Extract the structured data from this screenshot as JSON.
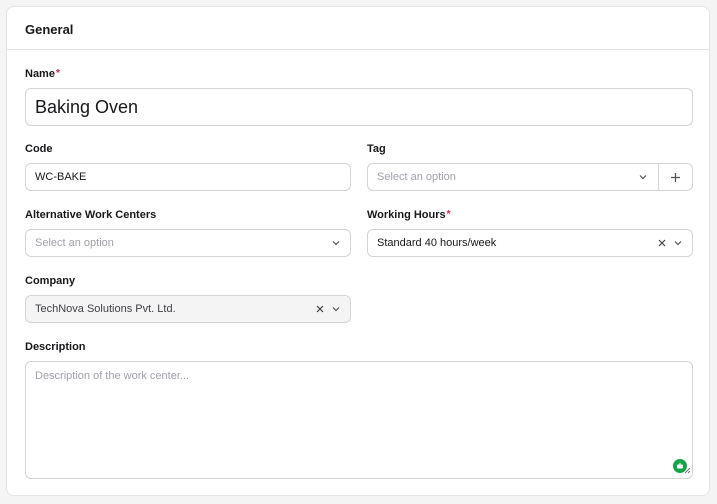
{
  "section": {
    "title": "General"
  },
  "fields": {
    "name": {
      "label": "Name",
      "required_mark": "*",
      "value": "Baking Oven"
    },
    "code": {
      "label": "Code",
      "value": "WC-BAKE"
    },
    "tag": {
      "label": "Tag",
      "placeholder": "Select an option"
    },
    "alt_work_centers": {
      "label": "Alternative Work Centers",
      "placeholder": "Select an option"
    },
    "working_hours": {
      "label": "Working Hours",
      "required_mark": "*",
      "value": "Standard 40 hours/week"
    },
    "company": {
      "label": "Company",
      "value": "TechNova Solutions Pvt. Ltd."
    },
    "description": {
      "label": "Description",
      "placeholder": "Description of the work center..."
    }
  },
  "colors": {
    "required": "#e11d48",
    "assist_icon": "#16a34a",
    "border": "#d4d4d8"
  },
  "icons": [
    "chevron-down-icon",
    "clear-icon",
    "plus-icon",
    "assist-icon",
    "resize-handle-icon"
  ]
}
